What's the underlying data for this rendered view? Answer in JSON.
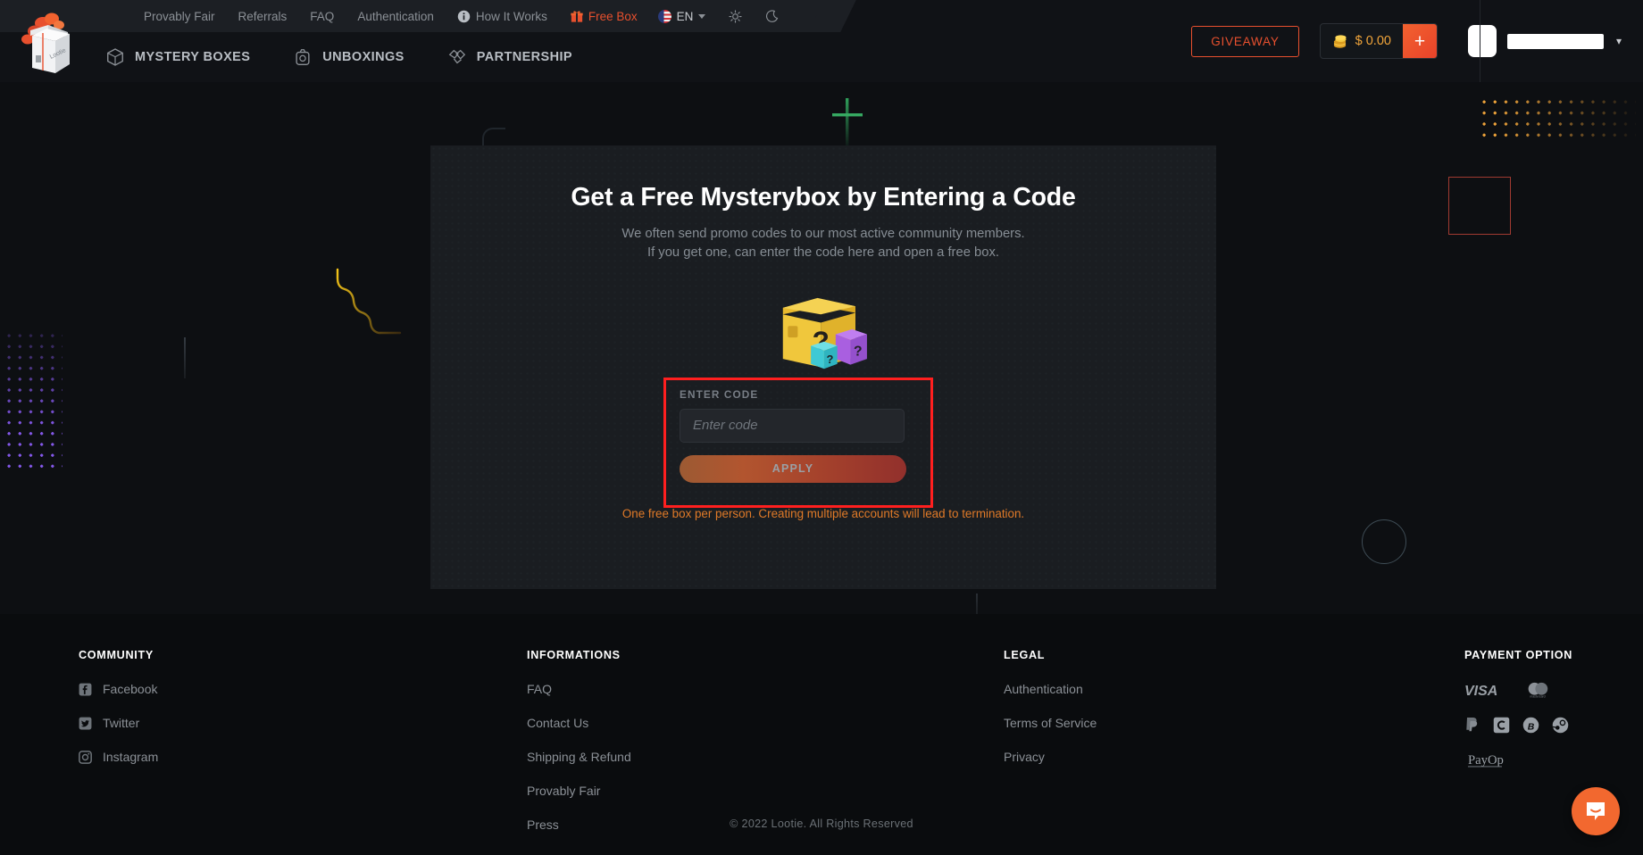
{
  "header": {
    "utility_nav": [
      {
        "label": "Provably Fair",
        "icon": null,
        "accent": false
      },
      {
        "label": "Referrals",
        "icon": null,
        "accent": false
      },
      {
        "label": "FAQ",
        "icon": null,
        "accent": false
      },
      {
        "label": "Authentication",
        "icon": null,
        "accent": false
      },
      {
        "label": "How It Works",
        "icon": "info-circle-icon",
        "accent": false
      },
      {
        "label": "Free Box",
        "icon": "gift-icon",
        "accent": true
      }
    ],
    "language": {
      "label": "EN",
      "flag": "us-flag-icon",
      "chevron": "chevron-down-icon"
    },
    "theme_light_icon": "sun-icon",
    "theme_dark_icon": "moon-icon",
    "logo_name": "lootie-box-logo",
    "main_nav": [
      {
        "label": "MYSTERY BOXES",
        "icon": "cube-icon"
      },
      {
        "label": "UNBOXINGS",
        "icon": "camera-icon"
      },
      {
        "label": "PARTNERSHIP",
        "icon": "handshake-icon"
      }
    ],
    "giveaway_label": "GIVEAWAY",
    "balance": {
      "amount": "$ 0.00",
      "coins_icon": "coins-icon",
      "add_label": "+"
    },
    "user": {
      "avatar": "user-avatar",
      "username": "",
      "chevron": "chevron-down-icon"
    }
  },
  "card": {
    "title": "Get a Free Mysterybox by Entering a Code",
    "subtitle_line1": "We often send promo codes to our most active community members.",
    "subtitle_line2": "If you get one, can enter the code here and open a free box.",
    "illustration": "mystery-boxes-illustration",
    "field_label": "ENTER CODE",
    "input_value": "",
    "input_placeholder": "Enter code",
    "apply_label": "APPLY",
    "warning": "One free box per person. Creating multiple accounts will lead to termination."
  },
  "footer": {
    "community": {
      "heading": "COMMUNITY",
      "links": [
        {
          "label": "Facebook",
          "icon": "facebook-icon"
        },
        {
          "label": "Twitter",
          "icon": "twitter-icon"
        },
        {
          "label": "Instagram",
          "icon": "instagram-icon"
        }
      ]
    },
    "informations": {
      "heading": "INFORMATIONS",
      "links": [
        {
          "label": "FAQ"
        },
        {
          "label": "Contact Us"
        },
        {
          "label": "Shipping & Refund"
        },
        {
          "label": "Provably Fair"
        },
        {
          "label": "Press"
        }
      ]
    },
    "legal": {
      "heading": "LEGAL",
      "links": [
        {
          "label": "Authentication"
        },
        {
          "label": "Terms of Service"
        },
        {
          "label": "Privacy"
        }
      ]
    },
    "payment": {
      "heading": "PAYMENT OPTION",
      "icons_row1": [
        "visa-icon",
        "mastercard-icon"
      ],
      "icons_row2": [
        "paypal-icon",
        "coinbase-icon",
        "bitcoin-icon",
        "steam-icon"
      ],
      "icons_row3": [
        "payop-icon"
      ]
    },
    "copyright": "© 2022 Lootie. All Rights Reserved"
  },
  "support": {
    "chat_icon": "intercom-chat-icon"
  },
  "colors": {
    "accent_orange": "#e8502e",
    "balance_gold": "#f0a43a",
    "warning_orange": "#e07a28",
    "highlight_red": "#ff1f1f",
    "card_bg": "#1a1d21",
    "page_bg": "#0d0f12"
  }
}
